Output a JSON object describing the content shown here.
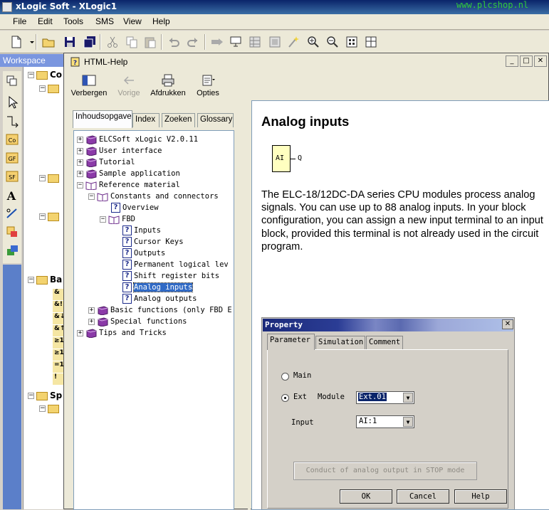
{
  "app": {
    "title": "xLogic Soft - XLogic1",
    "watermark": "www.plcshop.nl",
    "menu": [
      "File",
      "Edit",
      "Tools",
      "SMS",
      "View",
      "Help"
    ]
  },
  "workspace": {
    "header": "Workspace",
    "tree": [
      {
        "label": "Co"
      },
      {
        "label": ""
      },
      {
        "label": ""
      },
      {
        "label": ""
      },
      {
        "label": "Ba"
      },
      {
        "label": "Sp"
      },
      {
        "label": ""
      }
    ],
    "block_labels": [
      "&",
      "&!",
      "&↓",
      "&↑",
      "≥1",
      "≥1",
      "=1",
      "!"
    ],
    "palette_labels": [
      "Co",
      "GF",
      "SF"
    ]
  },
  "help": {
    "title": "HTML-Help",
    "toolbar": [
      {
        "label": "Verbergen",
        "icon": "hide-icon",
        "enabled": true
      },
      {
        "label": "Vorige",
        "icon": "back-arrow-icon",
        "enabled": false
      },
      {
        "label": "Afdrukken",
        "icon": "printer-icon",
        "enabled": true
      },
      {
        "label": "Opties",
        "icon": "options-icon",
        "enabled": true
      }
    ],
    "tabs": [
      "Inhoudsopgave",
      "Index",
      "Zoeken",
      "Glossary"
    ],
    "active_tab": "Inhoudsopgave",
    "tree": [
      {
        "label": "ELCSoft xLogic V2.0.11",
        "type": "book"
      },
      {
        "label": "User interface",
        "type": "book"
      },
      {
        "label": "Tutorial",
        "type": "book"
      },
      {
        "label": "Sample application",
        "type": "book"
      },
      {
        "label": "Reference material",
        "type": "book-open"
      },
      {
        "label": "Constants and connectors",
        "type": "book-open"
      },
      {
        "label": "Overview",
        "type": "page"
      },
      {
        "label": "FBD",
        "type": "book-open"
      },
      {
        "label": "Inputs",
        "type": "page"
      },
      {
        "label": "Cursor Keys",
        "type": "page"
      },
      {
        "label": "Outputs",
        "type": "page"
      },
      {
        "label": "Permanent logical lev",
        "type": "page"
      },
      {
        "label": "Shift register bits",
        "type": "page"
      },
      {
        "label": "Analog inputs",
        "type": "page",
        "selected": true
      },
      {
        "label": "Analog outputs",
        "type": "page"
      },
      {
        "label": "Basic functions (only FBD E",
        "type": "book"
      },
      {
        "label": "Special functions",
        "type": "book"
      },
      {
        "label": "Tips and Tricks",
        "type": "book"
      }
    ],
    "content": {
      "title": "Analog inputs",
      "block_label": "AI",
      "block_output": "Q",
      "paragraph": "The ELC-18/12DC-DA series CPU modules process analog signals. You can use up to 88 analog inputs. In your block configuration, you can assign a new input terminal to an input block, provided this terminal is not already used in the circuit program."
    }
  },
  "property_dialog": {
    "title": "Property",
    "tabs": [
      "Parameter",
      "Simulation",
      "Comment"
    ],
    "radio_main": "Main",
    "radio_ext": "Ext",
    "module_label": "Module",
    "module_value": "Ext.01",
    "input_label": "Input",
    "input_value": "AI:1",
    "conduct_button": "Conduct of analog output in STOP  mode",
    "ok": "OK",
    "cancel": "Cancel",
    "help": "Help"
  }
}
